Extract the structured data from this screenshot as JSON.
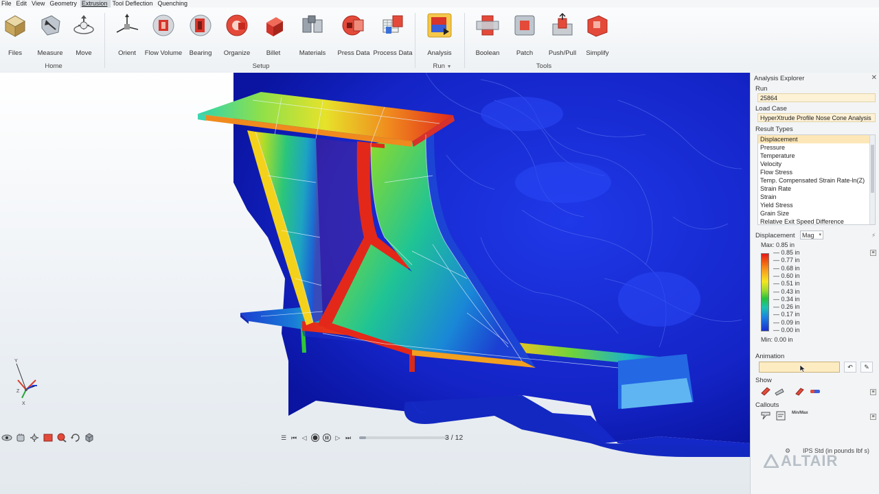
{
  "menu": [
    "File",
    "Edit",
    "View",
    "Geometry",
    "Extrusion",
    "Tool Deflection",
    "Quenching"
  ],
  "menu_active": 4,
  "ribbon": {
    "buttons": {
      "files": "Files",
      "measure": "Measure",
      "move": "Move",
      "orient": "Orient",
      "flow_volume": "Flow Volume",
      "bearing": "Bearing",
      "organize": "Organize",
      "billet": "Billet",
      "materials": "Materials",
      "press_data": "Press Data",
      "process_data": "Process Data",
      "analysis": "Analysis",
      "boolean": "Boolean",
      "patch": "Patch",
      "push_pull": "Push/Pull",
      "simplify": "Simplify"
    },
    "groups": {
      "home": "Home",
      "setup": "Setup",
      "run": "Run",
      "tools": "Tools"
    }
  },
  "explorer": {
    "title": "Analysis Explorer",
    "run_label": "Run",
    "run_value": "25864",
    "loadcase_label": "Load Case",
    "loadcase_value": "HyperXtrude Profile Nose Cone Analysis",
    "result_types_label": "Result Types",
    "result_types": [
      "Displacement",
      "Pressure",
      "Temperature",
      "Velocity",
      "Flow Stress",
      "Temp. Compensated Strain Rate-ln(Z)",
      "Strain Rate",
      "Strain",
      "Yield Stress",
      "Grain Size",
      "Relative Exit Speed Difference"
    ],
    "selected_result": 0,
    "displacement_label": "Displacement",
    "component": "Mag",
    "max_label": "Max:  0.85 in",
    "min_label": "Min:  0.00 in",
    "legend_values": [
      "0.85 in",
      "0.77 in",
      "0.68 in",
      "0.60 in",
      "0.51 in",
      "0.43 in",
      "0.34 in",
      "0.26 in",
      "0.17 in",
      "0.09 in",
      "0.00 in"
    ],
    "animation_label": "Animation",
    "show_label": "Show",
    "callouts_label": "Callouts",
    "minmax_icon_text": "Min/Max"
  },
  "playback": {
    "frame": "3 / 12",
    "progress": 0.08
  },
  "units": "IPS Std (in pounds lbf s)",
  "brand": "ALTAIR",
  "triad": {
    "x": "X",
    "y": "Y",
    "z": "Z"
  }
}
